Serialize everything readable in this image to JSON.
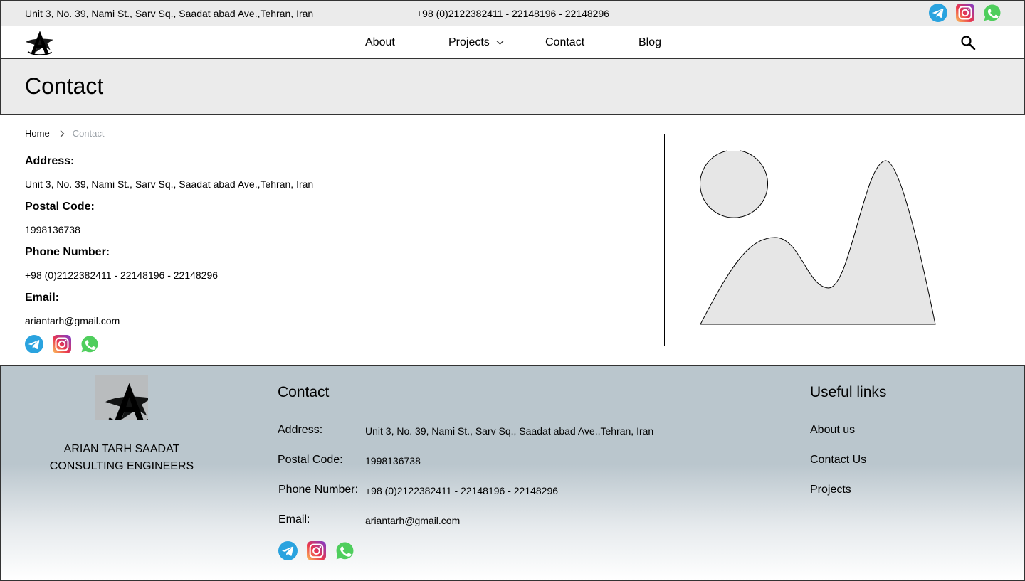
{
  "topbar": {
    "address": "Unit 3, No. 39, Nami St., Sarv Sq., Saadat abad Ave.,Tehran, Iran",
    "phone": "+98 (0)2122382411 - 22148196 - 22148296",
    "socials": [
      "telegram-icon",
      "instagram-icon",
      "whatsapp-icon"
    ]
  },
  "nav": {
    "items": [
      {
        "label": "About"
      },
      {
        "label": "Projects"
      },
      {
        "label": "Contact"
      },
      {
        "label": "Blog"
      }
    ]
  },
  "page": {
    "title": "Contact"
  },
  "breadcrumb": {
    "home": "Home",
    "current": "Contact"
  },
  "contact": {
    "address_label": "Address:",
    "address": "Unit 3, No. 39, Nami St., Sarv Sq., Saadat abad Ave.,Tehran, Iran",
    "postal_label": "Postal Code:",
    "postal": "1998136738",
    "phone_label": "Phone Number:",
    "phone": "+98 (0)2122382411 - 22148196 - 22148296",
    "email_label": "Email:",
    "email": "ariantarh@gmail.com"
  },
  "footer": {
    "company_line1": "ARIAN TARH SAADAT",
    "company_line2": "CONSULTING ENGINEERS",
    "contact_heading": "Contact",
    "address_label": "Address:",
    "address": "Unit 3, No. 39, Nami St., Sarv Sq., Saadat abad Ave.,Tehran, Iran",
    "postal_label": "Postal Code:",
    "postal": "1998136738",
    "phone_label": "Phone Number:",
    "phone": "+98 (0)2122382411 - 22148196 - 22148296",
    "email_label": "Email:",
    "email": "ariantarh@gmail.com",
    "links_heading": "Useful links",
    "links": [
      {
        "label": "About us"
      },
      {
        "label": "Contact Us"
      },
      {
        "label": "Projects"
      }
    ]
  },
  "colors": {
    "telegram": "#2aa3df",
    "whatsapp": "#4fce5d",
    "header_bg": "#ebebeb",
    "footer_bg": "#bac6cd",
    "breadcrumb_current": "#9aa0a6"
  }
}
